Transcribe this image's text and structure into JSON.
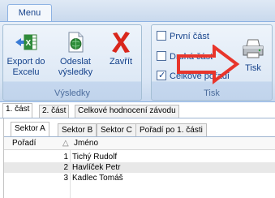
{
  "menu": {
    "tab_label": "Menu"
  },
  "ribbon": {
    "results_group": {
      "label": "Výsledky",
      "export": {
        "line1": "Export do",
        "line2": "Excelu",
        "icon": "excel-export-icon"
      },
      "send": {
        "line1": "Odeslat",
        "line2": "výsledky",
        "icon": "send-results-icon"
      },
      "close": {
        "label": "Zavřít",
        "icon": "close-x-icon"
      }
    },
    "print_group": {
      "label": "Tisk",
      "checkboxes": [
        {
          "label": "První část",
          "checked": false
        },
        {
          "label": "Druhá část",
          "checked": false
        },
        {
          "label": "Celkové pořadí",
          "checked": true
        }
      ],
      "print_button": {
        "label": "Tisk",
        "icon": "printer-icon"
      }
    },
    "annotation_arrow": {
      "color": "#e8352b",
      "icon": "red-arrow-icon"
    }
  },
  "tabs": [
    "1. část",
    "2. část",
    "Celkové hodnocení závodu"
  ],
  "subtabs": [
    "Sektor A",
    "Sektor B",
    "Sektor C",
    "Pořadí po 1. části"
  ],
  "grid": {
    "headers": {
      "rank": "Pořadí",
      "sort_icon": "△",
      "name": "Jméno"
    },
    "rows": [
      {
        "num": "1",
        "name": "Tichý Rudolf",
        "selected": false
      },
      {
        "num": "2",
        "name": "Havlíček Petr",
        "selected": true
      },
      {
        "num": "3",
        "name": "Kadlec Tomáš",
        "selected": false
      }
    ]
  }
}
